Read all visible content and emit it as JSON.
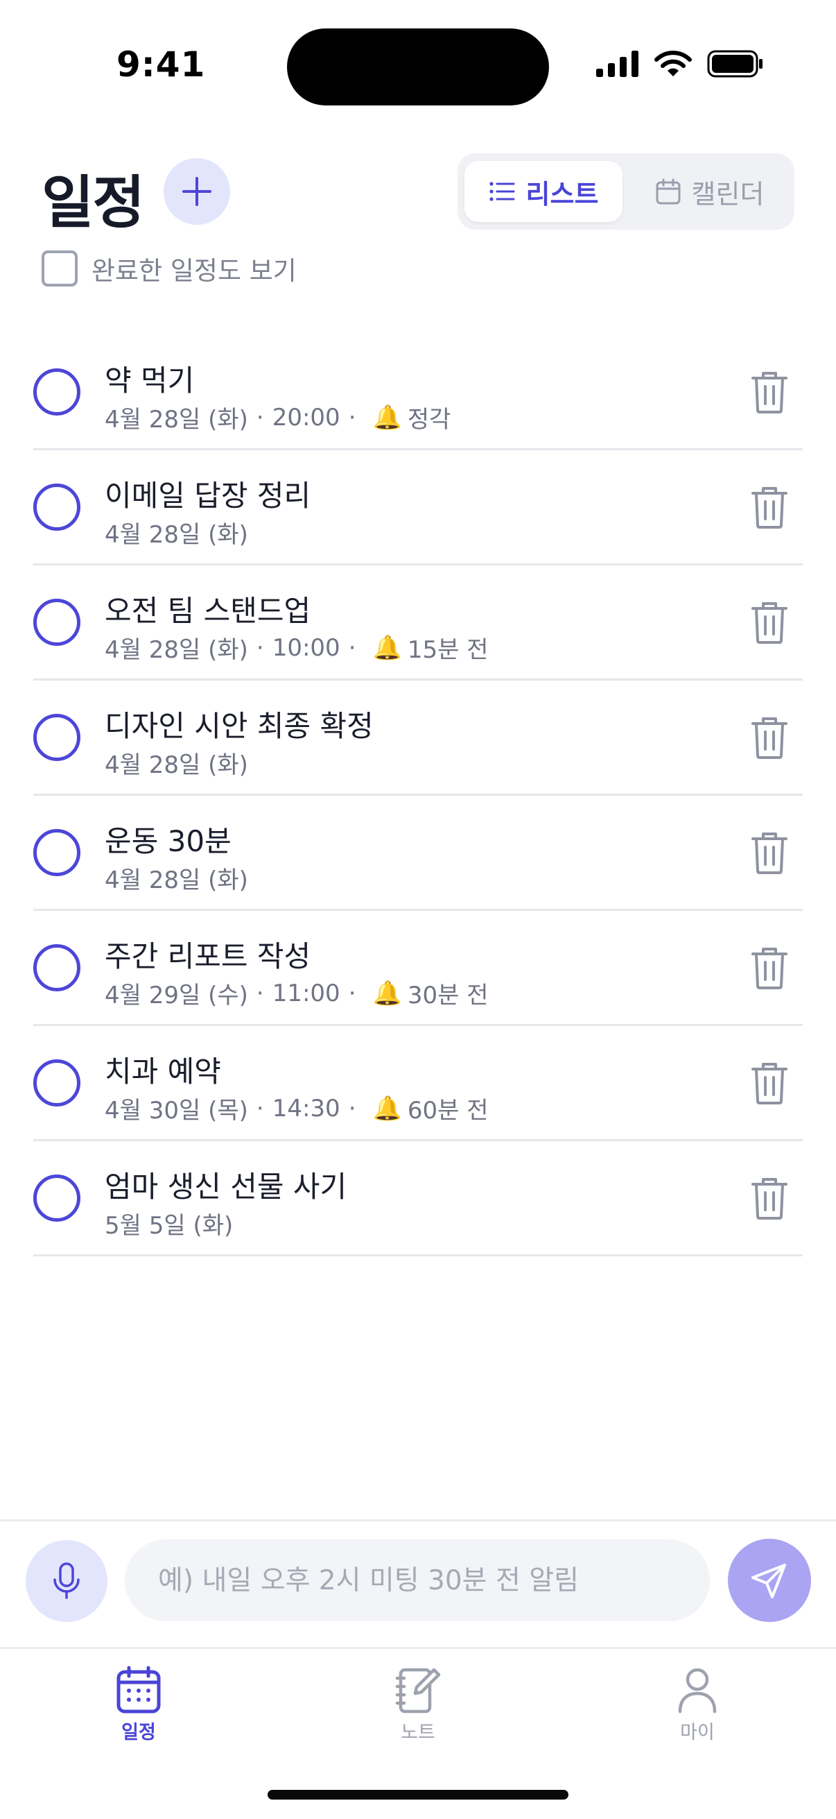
{
  "status": {
    "time": "9:41"
  },
  "header": {
    "title": "일정",
    "add_icon": "plus-icon",
    "view_toggle": {
      "list_label": "리스트",
      "calendar_label": "캘린더",
      "active": "list"
    },
    "show_completed": {
      "label": "완료한 일정도 보기",
      "checked": false
    }
  },
  "tasks": [
    {
      "title": "약 먹기",
      "date": "4월 28일 (화)",
      "time": "20:00",
      "alarm": "정각"
    },
    {
      "title": "이메일 답장 정리",
      "date": "4월 28일 (화)",
      "time": "",
      "alarm": ""
    },
    {
      "title": "오전 팀 스탠드업",
      "date": "4월 28일 (화)",
      "time": "10:00",
      "alarm": "15분 전"
    },
    {
      "title": "디자인 시안 최종 확정",
      "date": "4월 28일 (화)",
      "time": "",
      "alarm": ""
    },
    {
      "title": "운동 30분",
      "date": "4월 28일 (화)",
      "time": "",
      "alarm": ""
    },
    {
      "title": "주간 리포트 작성",
      "date": "4월 29일 (수)",
      "time": "11:00",
      "alarm": "30분 전"
    },
    {
      "title": "치과 예약",
      "date": "4월 30일 (목)",
      "time": "14:30",
      "alarm": "60분 전"
    },
    {
      "title": "엄마 생신 선물 사기",
      "date": "5월 5일 (화)",
      "time": "",
      "alarm": ""
    }
  ],
  "meta_separator": "·",
  "composer": {
    "placeholder": "예) 내일 오후 2시 미팅 30분 전 알림",
    "value": ""
  },
  "tab_bar": {
    "tabs": [
      {
        "label": "일정",
        "icon": "calendar-icon",
        "active": true
      },
      {
        "label": "노트",
        "icon": "notebook-icon",
        "active": false
      },
      {
        "label": "마이",
        "icon": "person-icon",
        "active": false
      }
    ]
  },
  "colors": {
    "accent": "#4d46d8",
    "accent_light": "#e3e5fd",
    "send_button": "#aaa4f3",
    "muted_text": "#6f7383",
    "divider": "#e6e7ec"
  }
}
